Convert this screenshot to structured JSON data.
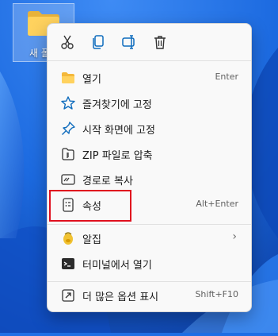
{
  "desktop": {
    "folder_label": "새 폴"
  },
  "toolbar": {
    "actions": [
      {
        "name": "cut",
        "icon": "scissors-icon"
      },
      {
        "name": "copy",
        "icon": "copy-icon"
      },
      {
        "name": "rename",
        "icon": "rename-icon"
      },
      {
        "name": "delete",
        "icon": "trash-icon"
      }
    ]
  },
  "menu": {
    "items": [
      {
        "label": "열기",
        "shortcut": "Enter",
        "icon": "folder-open-icon"
      },
      {
        "label": "즐겨찾기에 고정",
        "shortcut": "",
        "icon": "star-icon"
      },
      {
        "label": "시작 화면에 고정",
        "shortcut": "",
        "icon": "pin-icon"
      },
      {
        "label": "ZIP 파일로 압축",
        "shortcut": "",
        "icon": "zip-icon"
      },
      {
        "label": "경로로 복사",
        "shortcut": "",
        "icon": "copy-path-icon"
      },
      {
        "label": "속성",
        "shortcut": "Alt+Enter",
        "icon": "properties-icon"
      },
      {
        "label": "알집",
        "shortcut": "",
        "icon": "alzip-icon",
        "submenu": "›"
      },
      {
        "label": "터미널에서 열기",
        "shortcut": "",
        "icon": "terminal-icon"
      },
      {
        "label": "더 많은 옵션 표시",
        "shortcut": "Shift+F10",
        "icon": "more-options-icon"
      }
    ]
  },
  "colors": {
    "wallpaper": "#1f6fe6",
    "menu_bg": "#f9f9f9",
    "accent": "#0f6cbd",
    "highlight_border": "#e0101e"
  }
}
